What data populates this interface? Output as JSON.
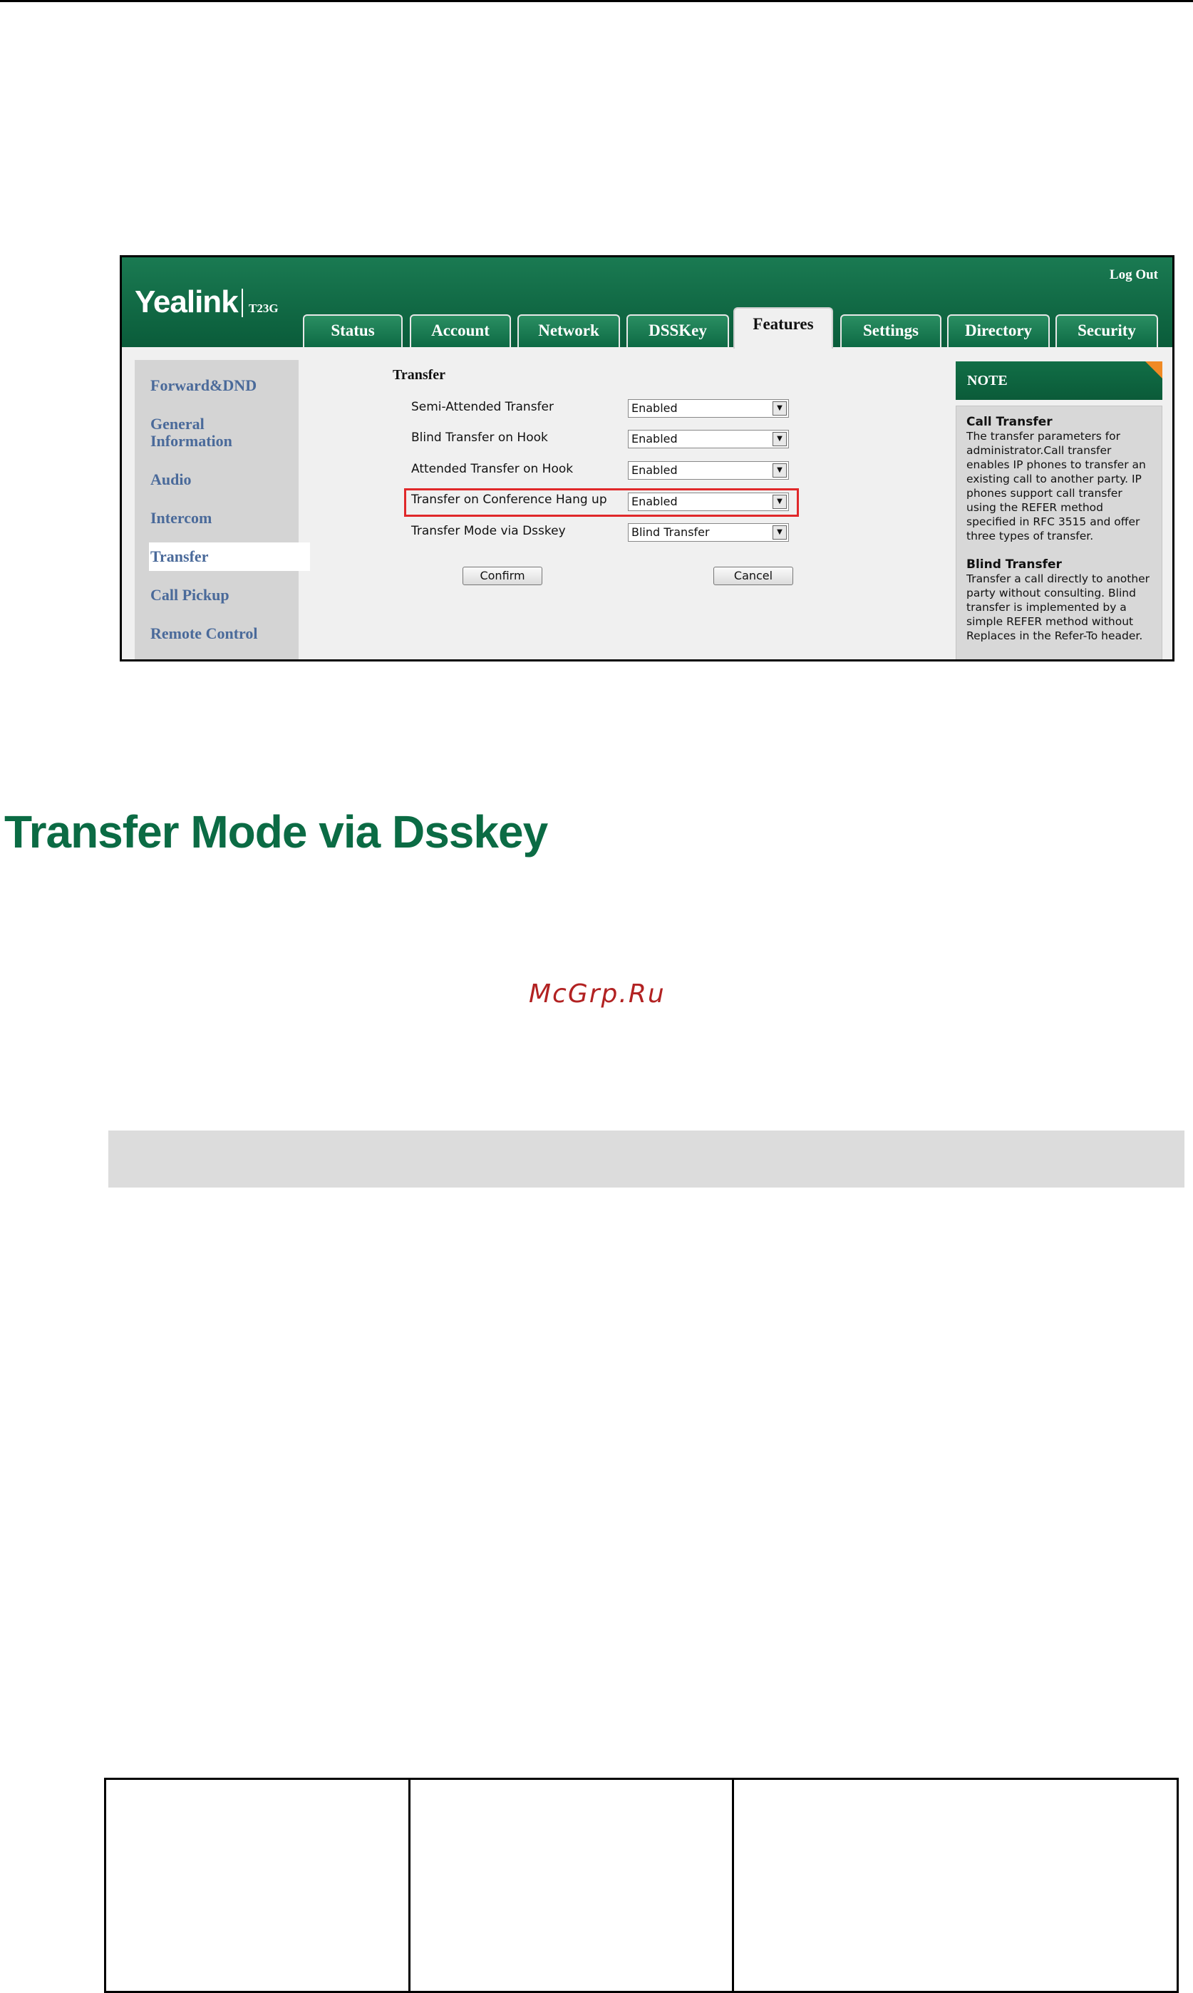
{
  "web_ui": {
    "brand": "Yealink",
    "model": "T23G",
    "logout": "Log Out",
    "tabs": [
      "Status",
      "Account",
      "Network",
      "DSSKey",
      "Features",
      "Settings",
      "Directory",
      "Security"
    ],
    "active_tab": "Features",
    "sidebar": [
      "Forward&DND",
      "General Information",
      "Audio",
      "Intercom",
      "Transfer",
      "Call Pickup",
      "Remote Control"
    ],
    "active_sidebar": "Transfer",
    "section_title": "Transfer",
    "rows": [
      {
        "label": "Semi-Attended Transfer",
        "value": "Enabled"
      },
      {
        "label": "Blind Transfer on Hook",
        "value": "Enabled"
      },
      {
        "label": "Attended Transfer on Hook",
        "value": "Enabled"
      },
      {
        "label": "Transfer on Conference Hang up",
        "value": "Enabled"
      },
      {
        "label": "Transfer Mode via Dsskey",
        "value": "Blind Transfer"
      }
    ],
    "confirm": "Confirm",
    "cancel": "Cancel",
    "note": {
      "title": "NOTE",
      "h1": "Call Transfer",
      "p1": "The transfer parameters for administrator.Call transfer enables IP phones to transfer an existing call to another party. IP phones support call transfer using the REFER method specified in RFC 3515 and offer three types of transfer.",
      "h2": "Blind Transfer",
      "p2": "Transfer a call directly to another party without consulting. Blind transfer is implemented by a simple REFER method without Replaces in the Refer-To header."
    }
  },
  "document": {
    "heading": "Transfer Mode via Dsskey",
    "watermark": "McGrp.Ru"
  }
}
